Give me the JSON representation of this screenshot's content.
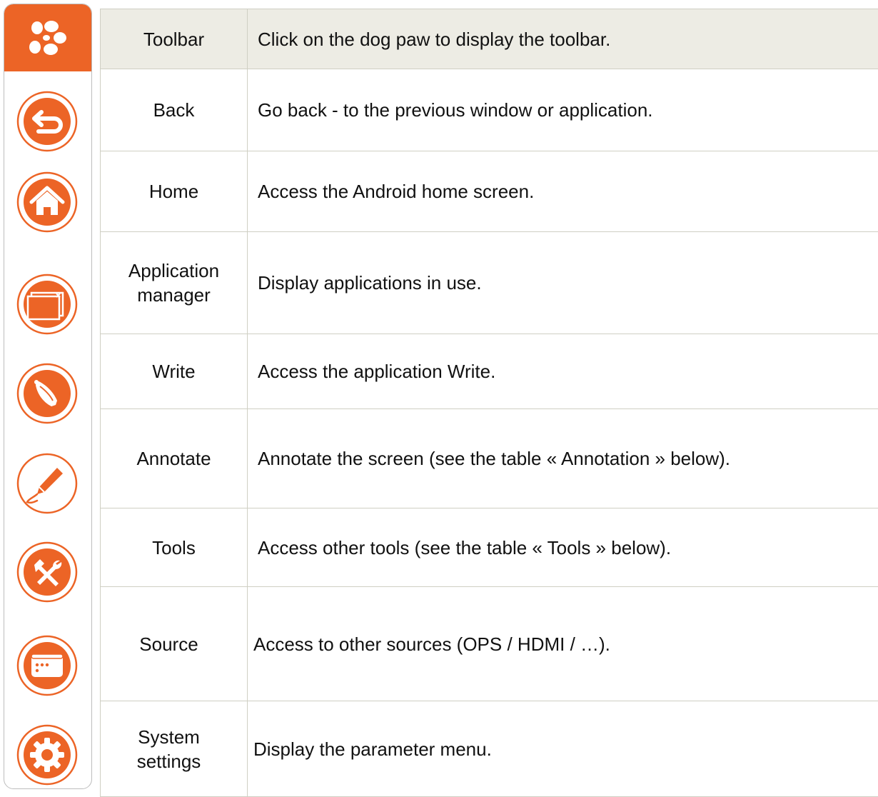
{
  "colors": {
    "accent": "#ec6426",
    "header_bg": "#edece4",
    "border": "#cfcfc3"
  },
  "toolbar": {
    "icons": [
      "dog-paw-icon",
      "back-icon",
      "home-icon",
      "application-manager-icon",
      "write-icon",
      "annotate-icon",
      "tools-icon",
      "source-icon",
      "system-settings-icon"
    ]
  },
  "table": {
    "rows": [
      {
        "name": "Toolbar",
        "description": "Click on the dog paw to display the toolbar."
      },
      {
        "name": "Back",
        "description": "Go back - to the previous window or application."
      },
      {
        "name": "Home",
        "description": "Access the Android home screen."
      },
      {
        "name": "Application manager",
        "description": "Display applications in use."
      },
      {
        "name": "Write",
        "description": "Access the application Write."
      },
      {
        "name": "Annotate",
        "description": "Annotate the screen (see the table « Annotation » below)."
      },
      {
        "name": "Tools",
        "description": "Access other tools (see the table « Tools » below)."
      },
      {
        "name": "Source",
        "description": "Access to other sources (OPS / HDMI / …)."
      },
      {
        "name": "System settings",
        "description": "Display the parameter menu."
      }
    ]
  }
}
